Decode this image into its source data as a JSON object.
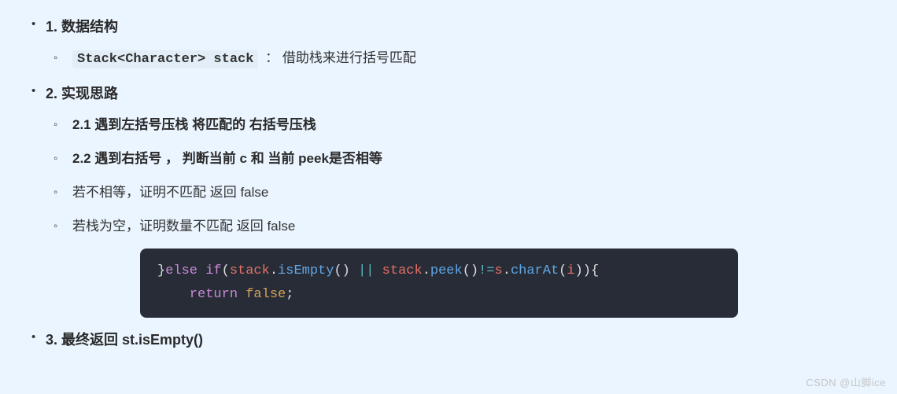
{
  "items": {
    "h1_1": "1. 数据结构",
    "h1_1_code": "Stack<Character> stack",
    "h1_1_desc": " ： 借助栈来进行括号匹配",
    "h1_2": "2. 实现思路",
    "h1_2_sub1": "2.1 遇到左括号压栈 将匹配的 右括号压栈",
    "h1_2_sub2": "2.2 遇到右括号 ， 判断当前 c 和 当前 peek是否相等",
    "h1_2_sub3": "若不相等，证明不匹配 返回 false",
    "h1_2_sub4": "若栈为空，证明数量不匹配 返回 false",
    "h1_3": "3. 最终返回 st.isEmpty()"
  },
  "code": {
    "l1_brace": "}",
    "l1_else": "else",
    "l1_if": " if",
    "l1_paren_o": "(",
    "l1_stack1": "stack",
    "l1_dot1": ".",
    "l1_isEmpty": "isEmpty",
    "l1_call1": "() ",
    "l1_or": "||",
    "l1_stack2": " stack",
    "l1_dot2": ".",
    "l1_peek": "peek",
    "l1_call2": "()",
    "l1_neq": "!=",
    "l1_s": "s",
    "l1_dot3": ".",
    "l1_charAt": "charAt",
    "l1_paren_o2": "(",
    "l1_i": "i",
    "l1_close": ")){",
    "l2_indent": "    ",
    "l2_return": "return",
    "l2_sp": " ",
    "l2_false": "false",
    "l2_semi": ";"
  },
  "watermark": "CSDN @山脚ice"
}
